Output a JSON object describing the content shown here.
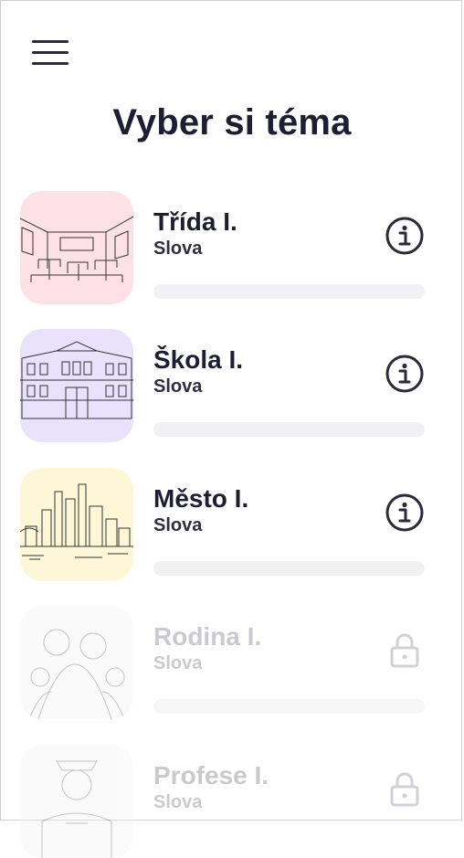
{
  "header": {
    "menu_icon": "hamburger-icon",
    "title": "Vyber si téma"
  },
  "topics": [
    {
      "title": "Třída I.",
      "subtitle": "Slova",
      "state": "unlocked",
      "action_icon": "info-icon",
      "progress": 0,
      "thumb_color": "#fde1e6",
      "illustration": "classroom"
    },
    {
      "title": "Škola I.",
      "subtitle": "Slova",
      "state": "unlocked",
      "action_icon": "info-icon",
      "progress": 0,
      "thumb_color": "#e9e2fd",
      "illustration": "school-building"
    },
    {
      "title": "Město I.",
      "subtitle": "Slova",
      "state": "unlocked",
      "action_icon": "info-icon",
      "progress": 0,
      "thumb_color": "#fdf7d8",
      "illustration": "city-skyline"
    },
    {
      "title": "Rodina I.",
      "subtitle": "Slova",
      "state": "locked",
      "action_icon": "lock-icon",
      "progress": 0,
      "thumb_color": "#f3f3f3",
      "illustration": "family"
    },
    {
      "title": "Profese I.",
      "subtitle": "Slova",
      "state": "locked",
      "action_icon": "lock-icon",
      "progress": 0,
      "thumb_color": "#f3f3f3",
      "illustration": "policeman"
    }
  ],
  "colors": {
    "text": "#1f1d33",
    "locked_text": "#c9c9cf",
    "progress_track": "#f1f1f3"
  }
}
